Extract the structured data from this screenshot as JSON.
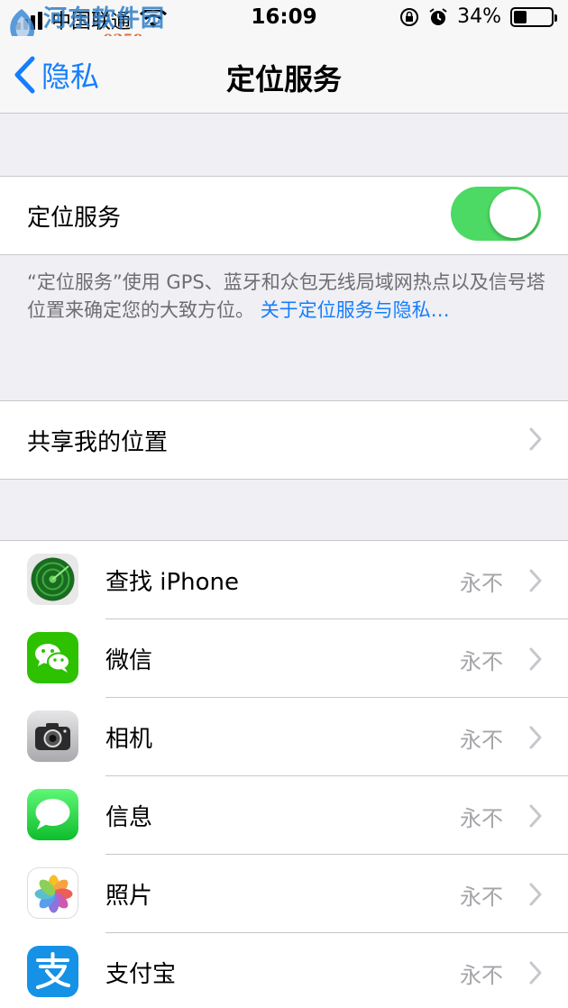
{
  "status": {
    "carrier": "中国联通",
    "time": "16:09",
    "battery": "34%",
    "battery_level": 0.34
  },
  "watermark": {
    "title": "河东软件园",
    "url": "www.pc0359.cn"
  },
  "nav": {
    "back_label": "隐私",
    "title": "定位服务"
  },
  "location_toggle": {
    "label": "定位服务",
    "on": true
  },
  "footer": {
    "text": "“定位服务”使用 GPS、蓝牙和众包无线局域网热点以及信号塔位置来确定您的大致方位。",
    "link": "关于定位服务与隐私…"
  },
  "share": {
    "label": "共享我的位置"
  },
  "apps": [
    {
      "name": "查找 iPhone",
      "value": "永不",
      "icon": "find-iphone-icon"
    },
    {
      "name": "微信",
      "value": "永不",
      "icon": "wechat-icon"
    },
    {
      "name": "相机",
      "value": "永不",
      "icon": "camera-icon"
    },
    {
      "name": "信息",
      "value": "永不",
      "icon": "messages-icon"
    },
    {
      "name": "照片",
      "value": "永不",
      "icon": "photos-icon"
    },
    {
      "name": "支付宝",
      "value": "永不",
      "icon": "alipay-icon"
    }
  ],
  "colors": {
    "accent": "#157efb",
    "toggle_on": "#4cd964",
    "background": "#efeff4"
  }
}
